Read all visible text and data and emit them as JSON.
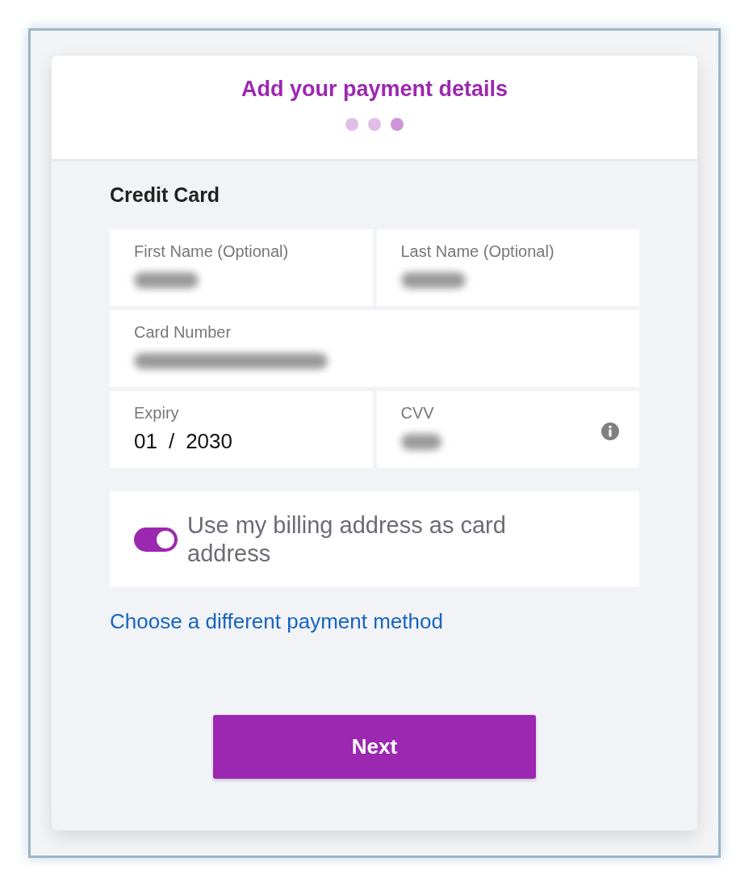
{
  "header": {
    "title": "Add your payment details",
    "steps": [
      {
        "selected": false
      },
      {
        "selected": false
      },
      {
        "selected": true
      }
    ]
  },
  "section_title": "Credit Card",
  "field_rows": [
    [
      {
        "kind": "name",
        "label": "First Name (Optional)",
        "value_hidden": true
      },
      {
        "kind": "name",
        "label": "Last Name (Optional)",
        "value_hidden": true
      }
    ],
    [
      {
        "kind": "card",
        "label": "Card Number",
        "value_hidden": true
      }
    ],
    [
      {
        "kind": "expiry",
        "label": "Expiry",
        "month": "01",
        "separator": "/",
        "year": "2030"
      },
      {
        "kind": "cvv",
        "label": "CVV",
        "value_hidden": true,
        "info": true
      }
    ]
  ],
  "billing_toggle": {
    "on": true,
    "label": "Use my billing address as card address"
  },
  "link": "Choose a different payment method",
  "next_button": "Next"
}
